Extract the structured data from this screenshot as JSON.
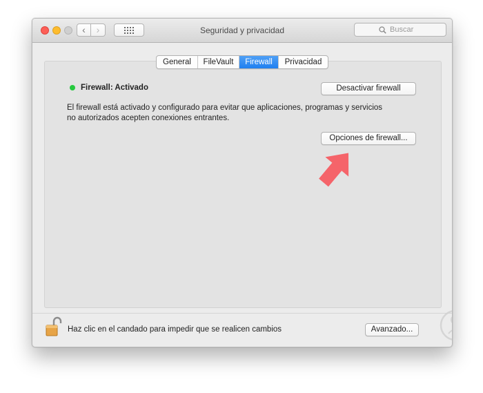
{
  "window": {
    "title": "Seguridad y privacidad",
    "search_placeholder": "Buscar"
  },
  "tabs": [
    {
      "label": "General",
      "active": false
    },
    {
      "label": "FileVault",
      "active": false
    },
    {
      "label": "Firewall",
      "active": true
    },
    {
      "label": "Privacidad",
      "active": false
    }
  ],
  "firewall": {
    "status": "Firewall: Activado",
    "status_color": "#27c93f",
    "deactivate_label": "Desactivar firewall",
    "description": "El firewall está activado y configurado para evitar que aplicaciones, programas y servicios no autorizados acepten conexiones entrantes.",
    "options_label": "Opciones de firewall..."
  },
  "footer": {
    "lock_text": "Haz clic en el candado para impedir que se realicen cambios",
    "advanced_label": "Avanzado..."
  },
  "icons": {
    "back": "chevron-left-icon",
    "forward": "chevron-right-icon",
    "show_all": "grid-icon",
    "search": "search-icon",
    "lock": "unlocked-padlock-icon",
    "annotation": "red-arrow-icon",
    "watermark": "solvetic-logo-icon"
  },
  "colors": {
    "accent": "#1f7ff0",
    "arrow": "#f5646a"
  }
}
